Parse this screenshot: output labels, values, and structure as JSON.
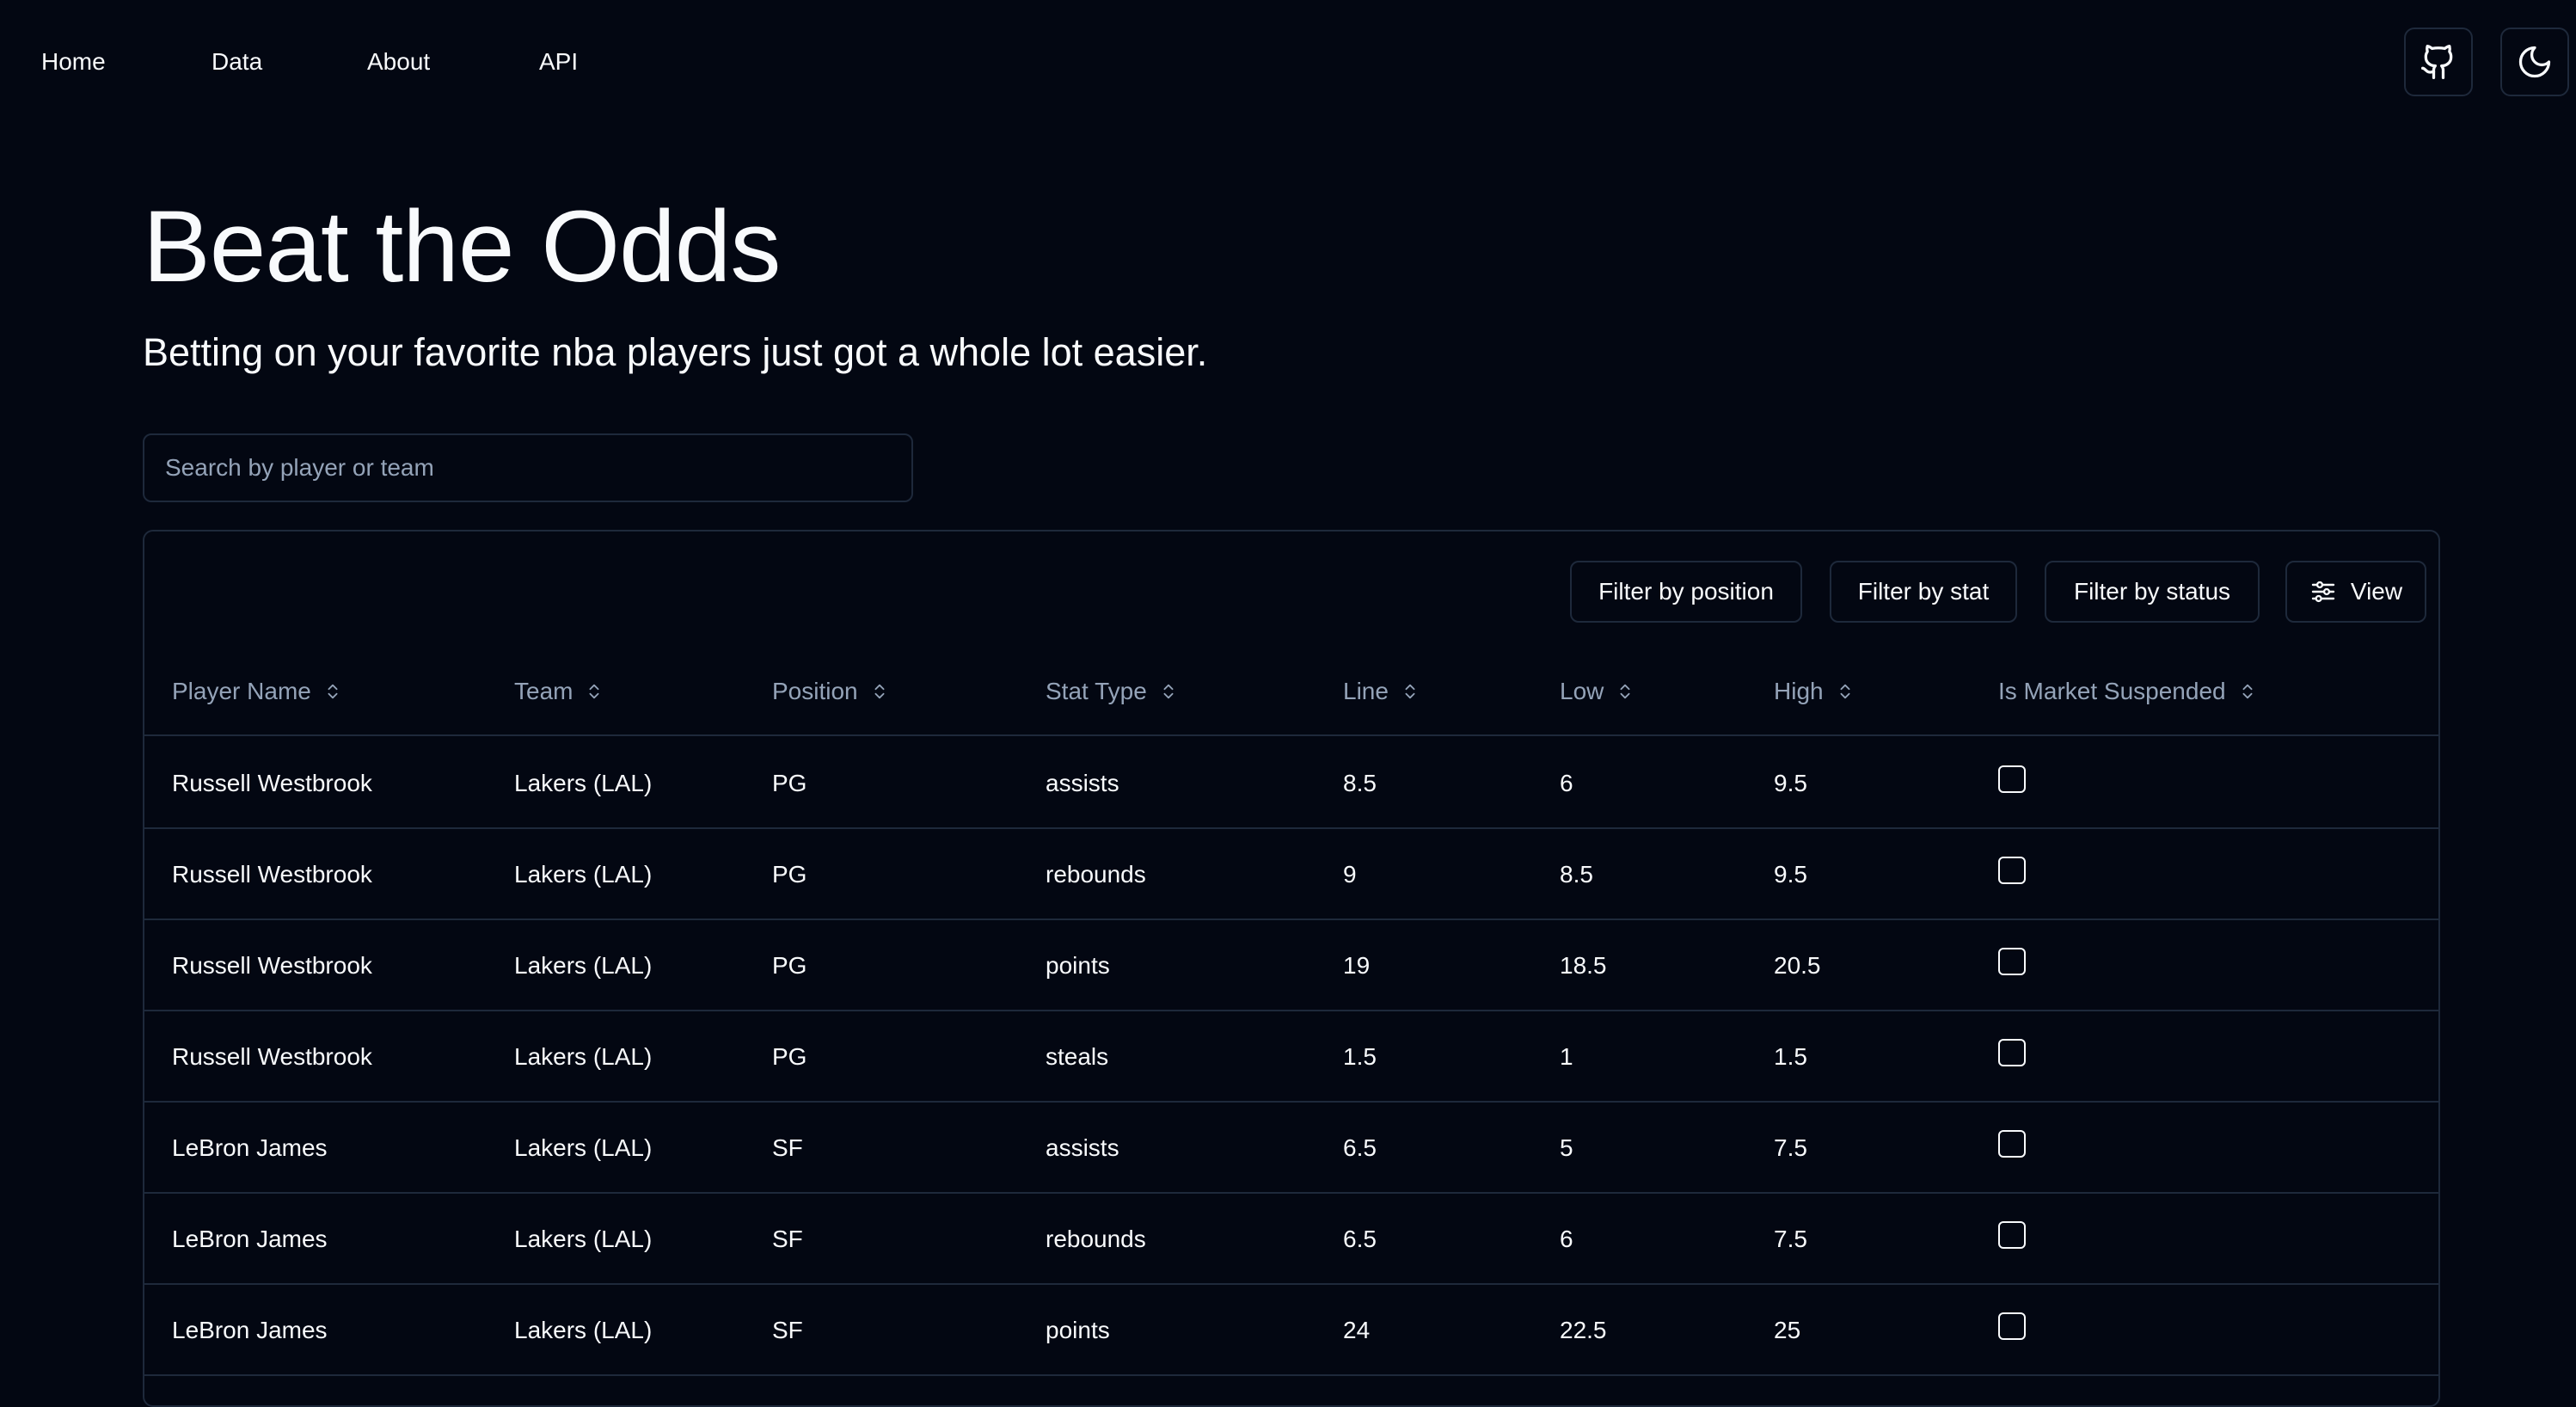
{
  "nav": {
    "links": [
      "Home",
      "Data",
      "About",
      "API"
    ]
  },
  "header_icons": [
    "github-icon",
    "moon-icon"
  ],
  "hero": {
    "title": "Beat the Odds",
    "subtitle": "Betting on your favorite nba players just got a whole lot easier."
  },
  "search": {
    "placeholder": "Search by player or team",
    "value": ""
  },
  "toolbar": {
    "filter_position": "Filter by position",
    "filter_stat": "Filter by stat",
    "filter_status": "Filter by status",
    "view": "View"
  },
  "table": {
    "columns": [
      "Player Name",
      "Team",
      "Position",
      "Stat Type",
      "Line",
      "Low",
      "High",
      "Is Market Suspended"
    ],
    "rows": [
      {
        "player": "Russell Westbrook",
        "team": "Lakers (LAL)",
        "position": "PG",
        "stat": "assists",
        "line": "8.5",
        "low": "6",
        "high": "9.5",
        "suspended": false
      },
      {
        "player": "Russell Westbrook",
        "team": "Lakers (LAL)",
        "position": "PG",
        "stat": "rebounds",
        "line": "9",
        "low": "8.5",
        "high": "9.5",
        "suspended": false
      },
      {
        "player": "Russell Westbrook",
        "team": "Lakers (LAL)",
        "position": "PG",
        "stat": "points",
        "line": "19",
        "low": "18.5",
        "high": "20.5",
        "suspended": false
      },
      {
        "player": "Russell Westbrook",
        "team": "Lakers (LAL)",
        "position": "PG",
        "stat": "steals",
        "line": "1.5",
        "low": "1",
        "high": "1.5",
        "suspended": false
      },
      {
        "player": "LeBron James",
        "team": "Lakers (LAL)",
        "position": "SF",
        "stat": "assists",
        "line": "6.5",
        "low": "5",
        "high": "7.5",
        "suspended": false
      },
      {
        "player": "LeBron James",
        "team": "Lakers (LAL)",
        "position": "SF",
        "stat": "rebounds",
        "line": "6.5",
        "low": "6",
        "high": "7.5",
        "suspended": false
      },
      {
        "player": "LeBron James",
        "team": "Lakers (LAL)",
        "position": "SF",
        "stat": "points",
        "line": "24",
        "low": "22.5",
        "high": "25",
        "suspended": false
      }
    ]
  },
  "colors": {
    "background": "#030712",
    "border": "#1e293b",
    "text": "#f8fafc",
    "muted": "#94a3b8"
  }
}
